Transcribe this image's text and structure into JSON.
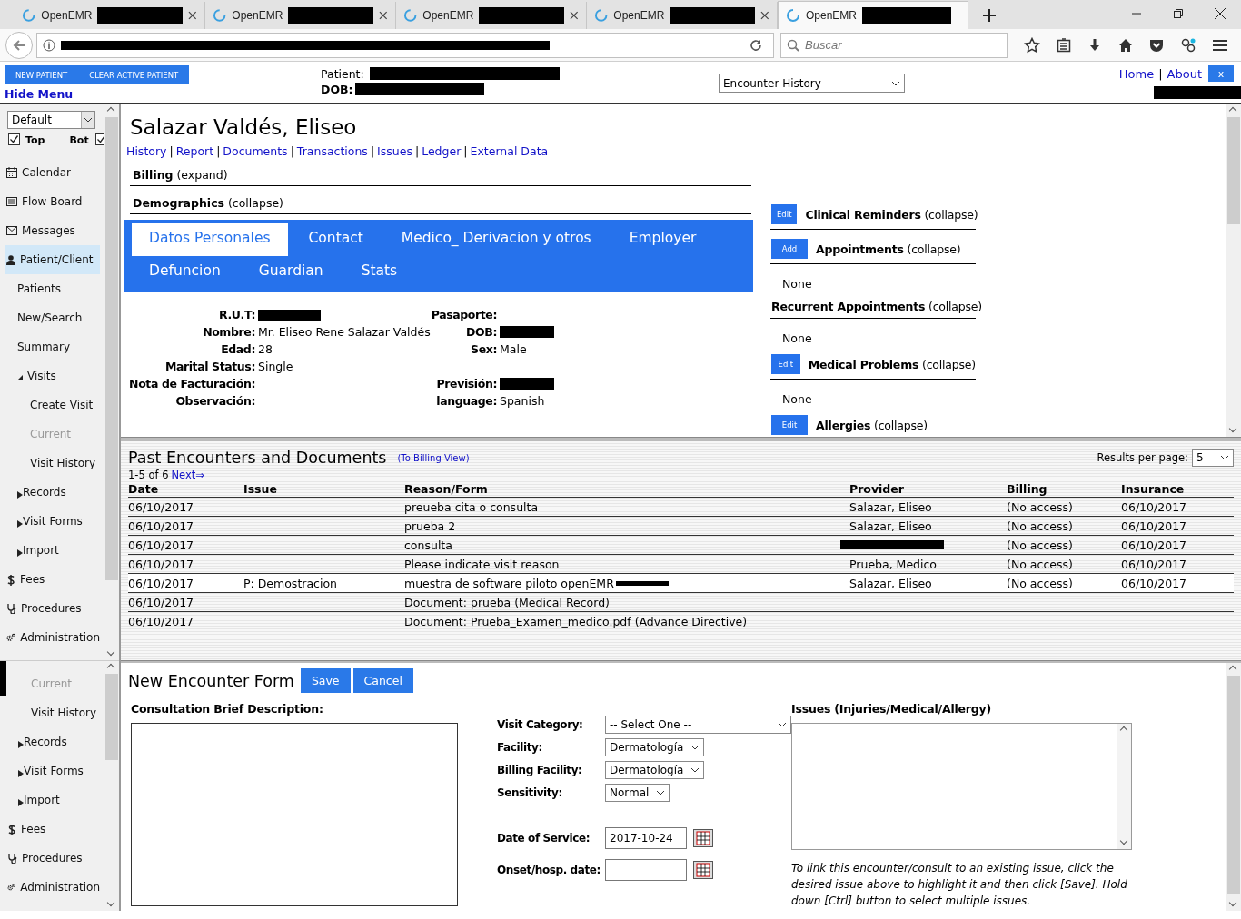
{
  "browser": {
    "tabs": [
      {
        "title": "OpenEMR",
        "selected": false
      },
      {
        "title": "OpenEMR",
        "selected": false
      },
      {
        "title": "OpenEMR",
        "selected": false
      },
      {
        "title": "OpenEMR",
        "selected": false
      },
      {
        "title": "OpenEMR",
        "selected": true
      }
    ],
    "search": {
      "placeholder": "Buscar"
    }
  },
  "header": {
    "buttons": [
      "NEW PATIENT",
      "CLEAR ACTIVE PATIENT"
    ],
    "hide_menu": "Hide Menu",
    "patient_label": "Patient:",
    "dob_label": "DOB:",
    "view_select": "Encounter History",
    "links": [
      "Home",
      "About"
    ],
    "separator": "|",
    "close": "x"
  },
  "sidebar": {
    "select": "Default",
    "checkboxes": [
      {
        "label": "Top",
        "checked": true
      },
      {
        "label": "Bot",
        "checked": true
      }
    ],
    "items": [
      {
        "label": "Calendar",
        "selected": false
      },
      {
        "label": "Flow Board",
        "selected": false
      },
      {
        "label": "Messages",
        "selected": false
      },
      {
        "label": "Patient/Client",
        "selected": true,
        "children": [
          {
            "label": "Patients"
          },
          {
            "label": "New/Search"
          },
          {
            "label": "Summary"
          },
          {
            "label": "Visits",
            "expanded": true,
            "children": [
              {
                "label": "Create Visit",
                "disabled": false
              },
              {
                "label": "Current",
                "disabled": true
              },
              {
                "label": "Visit History",
                "disabled": false
              }
            ]
          },
          {
            "label": "Records",
            "expanded": false
          },
          {
            "label": "Visit Forms",
            "expanded": false
          },
          {
            "label": "Import",
            "expanded": false
          }
        ]
      },
      {
        "label": "Fees",
        "selected": false
      },
      {
        "label": "Procedures",
        "selected": false
      },
      {
        "label": "Administration",
        "selected": false
      }
    ]
  },
  "sidebar_lower": {
    "items": [
      {
        "label": "Current",
        "kind": "sub",
        "disabled": true
      },
      {
        "label": "Visit History",
        "kind": "sub",
        "disabled": false
      },
      {
        "label": "Records",
        "kind": "group",
        "expanded": false
      },
      {
        "label": "Visit Forms",
        "kind": "group",
        "expanded": false
      },
      {
        "label": "Import",
        "kind": "group",
        "expanded": false
      },
      {
        "label": "Fees",
        "kind": "top"
      },
      {
        "label": "Procedures",
        "kind": "top"
      },
      {
        "label": "Administration",
        "kind": "top"
      }
    ]
  },
  "patient": {
    "name": "Salazar Valdés, Eliseo",
    "links": [
      "History",
      "Report",
      "Documents",
      "Transactions",
      "Issues",
      "Ledger",
      "External Data"
    ],
    "separator": "|",
    "sections": [
      {
        "title": "Billing",
        "toggle": "(expand)"
      },
      {
        "title": "Demographics",
        "toggle": "(collapse)"
      }
    ],
    "tabs": [
      {
        "label": "Datos Personales",
        "selected": true
      },
      {
        "label": "Contact",
        "selected": false
      },
      {
        "label": "Medico_ Derivacion y otros",
        "selected": false
      },
      {
        "label": "Employer",
        "selected": false
      },
      {
        "label": "Defuncion",
        "selected": false
      },
      {
        "label": "Guardian",
        "selected": false
      },
      {
        "label": "Stats",
        "selected": false
      }
    ],
    "fields": [
      {
        "left": {
          "label": "R.U.T:",
          "redacted": true
        },
        "right": {
          "label": "Pasaporte:"
        }
      },
      {
        "left": {
          "label": "Nombre:",
          "value": "Mr. Eliseo Rene Salazar Valdés"
        },
        "right": {
          "label": "DOB:",
          "redacted": true
        }
      },
      {
        "left": {
          "label": "Edad:",
          "value": "28"
        },
        "right": {
          "label": "Sex:",
          "value": "Male"
        }
      },
      {
        "left": {
          "label": "Marital Status:",
          "value": "Single"
        }
      },
      {
        "left": {
          "label": "Nota de Facturación:"
        },
        "right": {
          "label": "Previsión:",
          "redacted": true
        }
      },
      {
        "left": {
          "label": "Observación:"
        },
        "right": {
          "label": "language:",
          "value": "Spanish"
        }
      }
    ],
    "widgets": [
      {
        "button": "Edit",
        "title": "Clinical Reminders",
        "toggle": "(collapse)"
      },
      {
        "button": "Add",
        "title": "Appointments",
        "toggle": "(collapse)",
        "content": "None"
      },
      {
        "title": "Recurrent Appointments",
        "toggle": "(collapse)",
        "content": "None"
      },
      {
        "button": "Edit",
        "title": "Medical Problems",
        "toggle": "(collapse)",
        "content": "None"
      },
      {
        "button": "Edit",
        "title": "Allergies",
        "toggle": "(collapse)"
      }
    ]
  },
  "encounters": {
    "title": "Past Encounters and Documents",
    "billing_link": "(To Billing View)",
    "results_label": "Results per page:",
    "results_select": "5",
    "pager": "1-5 of 6",
    "next": "Next⇒",
    "columns": [
      "Date",
      "Issue",
      "Reason/Form",
      "Provider",
      "Billing",
      "Insurance"
    ],
    "rows": [
      {
        "date": "06/10/2017",
        "reason": "preueba cita o consulta",
        "provider": "Salazar, Eliseo",
        "billing": "(No access)",
        "insurance": "06/10/2017",
        "provider_redacted": false,
        "reason_redacted": false,
        "selected": false
      },
      {
        "date": "06/10/2017",
        "reason": "prueba 2",
        "provider": "Salazar, Eliseo",
        "billing": "(No access)",
        "insurance": "06/10/2017",
        "provider_redacted": false,
        "reason_redacted": false,
        "selected": false
      },
      {
        "date": "06/10/2017",
        "reason": "consulta",
        "billing": "(No access)",
        "insurance": "06/10/2017",
        "provider_redacted": true,
        "reason_redacted": false,
        "selected": false
      },
      {
        "date": "06/10/2017",
        "reason": "Please indicate visit reason",
        "provider": "Prueba, Medico",
        "billing": "(No access)",
        "insurance": "06/10/2017",
        "provider_redacted": false,
        "reason_redacted": false,
        "selected": false
      },
      {
        "date": "06/10/2017",
        "issue": "P: Demostracion",
        "reason": "muestra de software piloto openEMR",
        "provider": "Salazar, Eliseo",
        "billing": "(No access)",
        "insurance": "06/10/2017",
        "provider_redacted": false,
        "reason_redacted": true,
        "selected": true
      },
      {
        "date": "06/10/2017",
        "reason": "Document: prueba (Medical Record)",
        "provider_redacted": false,
        "reason_redacted": false,
        "selected": false
      },
      {
        "date": "06/10/2017",
        "reason": "Document: Prueba_Examen_medico.pdf (Advance Directive)",
        "provider_redacted": false,
        "reason_redacted": false,
        "selected": false
      }
    ]
  },
  "new_encounter": {
    "title": "New Encounter Form",
    "buttons": [
      "Save",
      "Cancel"
    ],
    "description_label": "Consultation Brief Description:",
    "fields": [
      {
        "label": "Visit Category:",
        "kind": "select",
        "value": "-- Select One --"
      },
      {
        "label": "Facility:",
        "kind": "select",
        "value": "Dermatología"
      },
      {
        "label": "Billing Facility:",
        "kind": "select",
        "value": "Dermatología"
      },
      {
        "label": "Sensitivity:",
        "kind": "select",
        "value": "Normal"
      },
      {
        "label": "Date of Service:",
        "kind": "date",
        "value": "2017-10-24"
      },
      {
        "label": "Onset/hosp. date:",
        "kind": "date"
      }
    ],
    "issues_label": "Issues (Injuries/Medical/Allergy)",
    "issues_help": "To link this encounter/consult to an existing issue, click the desired issue above to highlight it and then click [Save]. Hold down [Ctrl] button to select multiple issues."
  }
}
